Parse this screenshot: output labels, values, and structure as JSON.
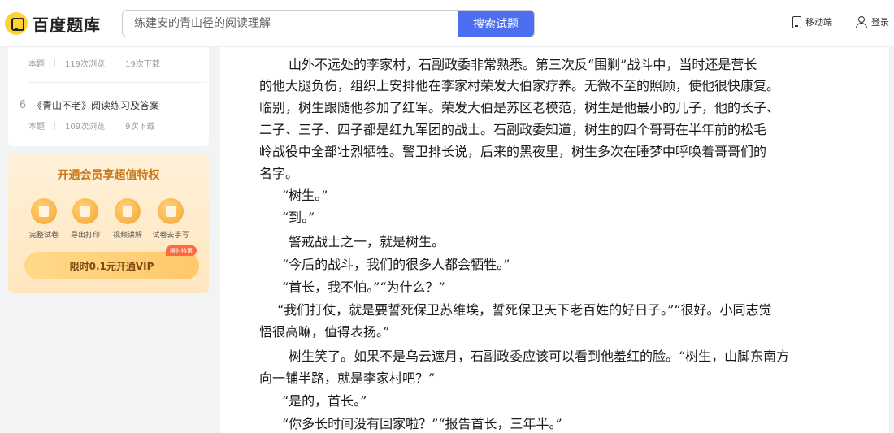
{
  "header": {
    "logo_text": "百度题库",
    "search_placeholder": "练建安的青山径的阅读理解",
    "search_button": "搜索试题",
    "mobile_label": "移动端",
    "login_label": "登录"
  },
  "sidebar": {
    "docs": [
      {
        "num": "",
        "title": "",
        "type": "本题",
        "views": "119次浏览",
        "downloads": "19次下载"
      },
      {
        "num": "6",
        "title": "《青山不老》阅读练习及答案",
        "type": "本题",
        "views": "109次浏览",
        "downloads": "9次下载"
      }
    ]
  },
  "vip": {
    "title": "开通会员享超值特权",
    "features": [
      {
        "label": "完整试卷",
        "icon": "paper-icon"
      },
      {
        "label": "导出打印",
        "icon": "print-icon"
      },
      {
        "label": "视频讲解",
        "icon": "video-icon"
      },
      {
        "label": "试卷去手写",
        "icon": "erase-icon"
      }
    ],
    "tag": "限时特惠",
    "button": "限时0.1元开通VIP"
  },
  "passage": {
    "lines": [
      "山外不远处的李家村，石副政委非常熟悉。第三次反“围剿”战斗中，当时还是营长",
      "的他大腿负伤，组织上安排他在李家村荣发大伯家疗养。无微不至的照顾，使他很快康复。",
      "临别，树生跟随他参加了红军。荣发大伯是苏区老模范，树生是他最小的儿子，他的长子、",
      "二子、三子、四子都是红九军团的战士。石副政委知道，树生的四个哥哥在半年前的松毛",
      "岭战役中全部壮烈牺牲。警卫排长说，后来的黑夜里，树生多次在睡梦中呼唤着哥哥们的",
      "名字。",
      "“树生。”",
      "“到。”",
      "警戒战士之一，就是树生。",
      "“今后的战斗，我们的很多人都会牺牲。”",
      "“首长，我不怕。”“为什么？”",
      "“我们打仗，就是要誓死保卫苏维埃，誓死保卫天下老百姓的好日子。”“很好。小同志觉",
      "悟很高嘛，值得表扬。”",
      "树生笑了。如果不是乌云遮月，石副政委应该可以看到他羞红的脸。“树生，山脚东南方",
      "向一铺半路，就是李家村吧？”",
      "“是的，首长。”",
      "“你多长时间没有回家啦？”“报告首长，三年半。”"
    ]
  }
}
